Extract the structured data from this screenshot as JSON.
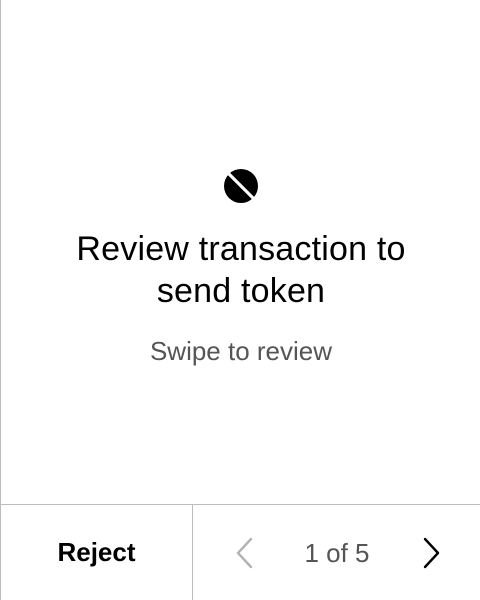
{
  "screen": {
    "icon": "ontology-token-icon",
    "title_line1": "Review transaction to",
    "title_line2": "send token",
    "subtitle": "Swipe to review"
  },
  "footer": {
    "reject_label": "Reject",
    "pager": {
      "label": "1 of 5",
      "current": 1,
      "total": 5,
      "prev_icon": "chevron-left-icon",
      "next_icon": "chevron-right-icon",
      "prev_color": "#b3b3b3",
      "next_color": "#000000"
    }
  },
  "colors": {
    "text": "#000000",
    "muted_text": "#555555",
    "divider": "#bdbdbd",
    "background": "#ffffff"
  }
}
